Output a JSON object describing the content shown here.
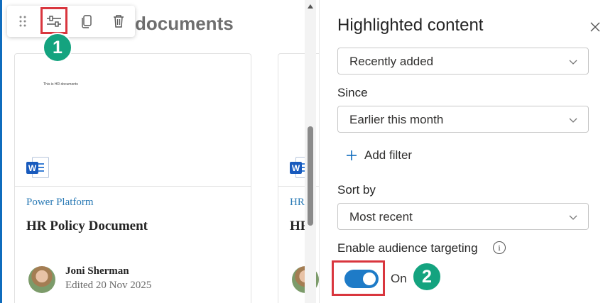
{
  "webpart": {
    "title_partial": "documents",
    "toolbar": {
      "icons": [
        "drag-handle-icon",
        "edit-properties-icon",
        "duplicate-icon",
        "delete-icon"
      ]
    },
    "cards": [
      {
        "preview_text": "This is HR documents",
        "file_type": "W",
        "category": "Power Platform",
        "title": "HR Policy Document",
        "author": "Joni Sherman",
        "edited": "Edited 20 Nov 2025"
      },
      {
        "file_type": "W",
        "category": "HR",
        "title": "HF"
      }
    ]
  },
  "steps": {
    "step1": "1",
    "step2": "2"
  },
  "panel": {
    "title": "Highlighted content",
    "content_type_value": "Recently added",
    "since_label": "Since",
    "since_value": "Earlier this month",
    "add_filter_label": "Add filter",
    "sort_by_label": "Sort by",
    "sort_by_value": "Most recent",
    "audience_targeting_label": "Enable audience targeting",
    "toggle_state_label": "On",
    "toggle_on": true
  },
  "colors": {
    "accent": "#0f6cbd",
    "toggle": "#1e7bc7",
    "highlight": "#d9363e",
    "badge": "#14a37f",
    "category_link": "#2a7ab5"
  }
}
